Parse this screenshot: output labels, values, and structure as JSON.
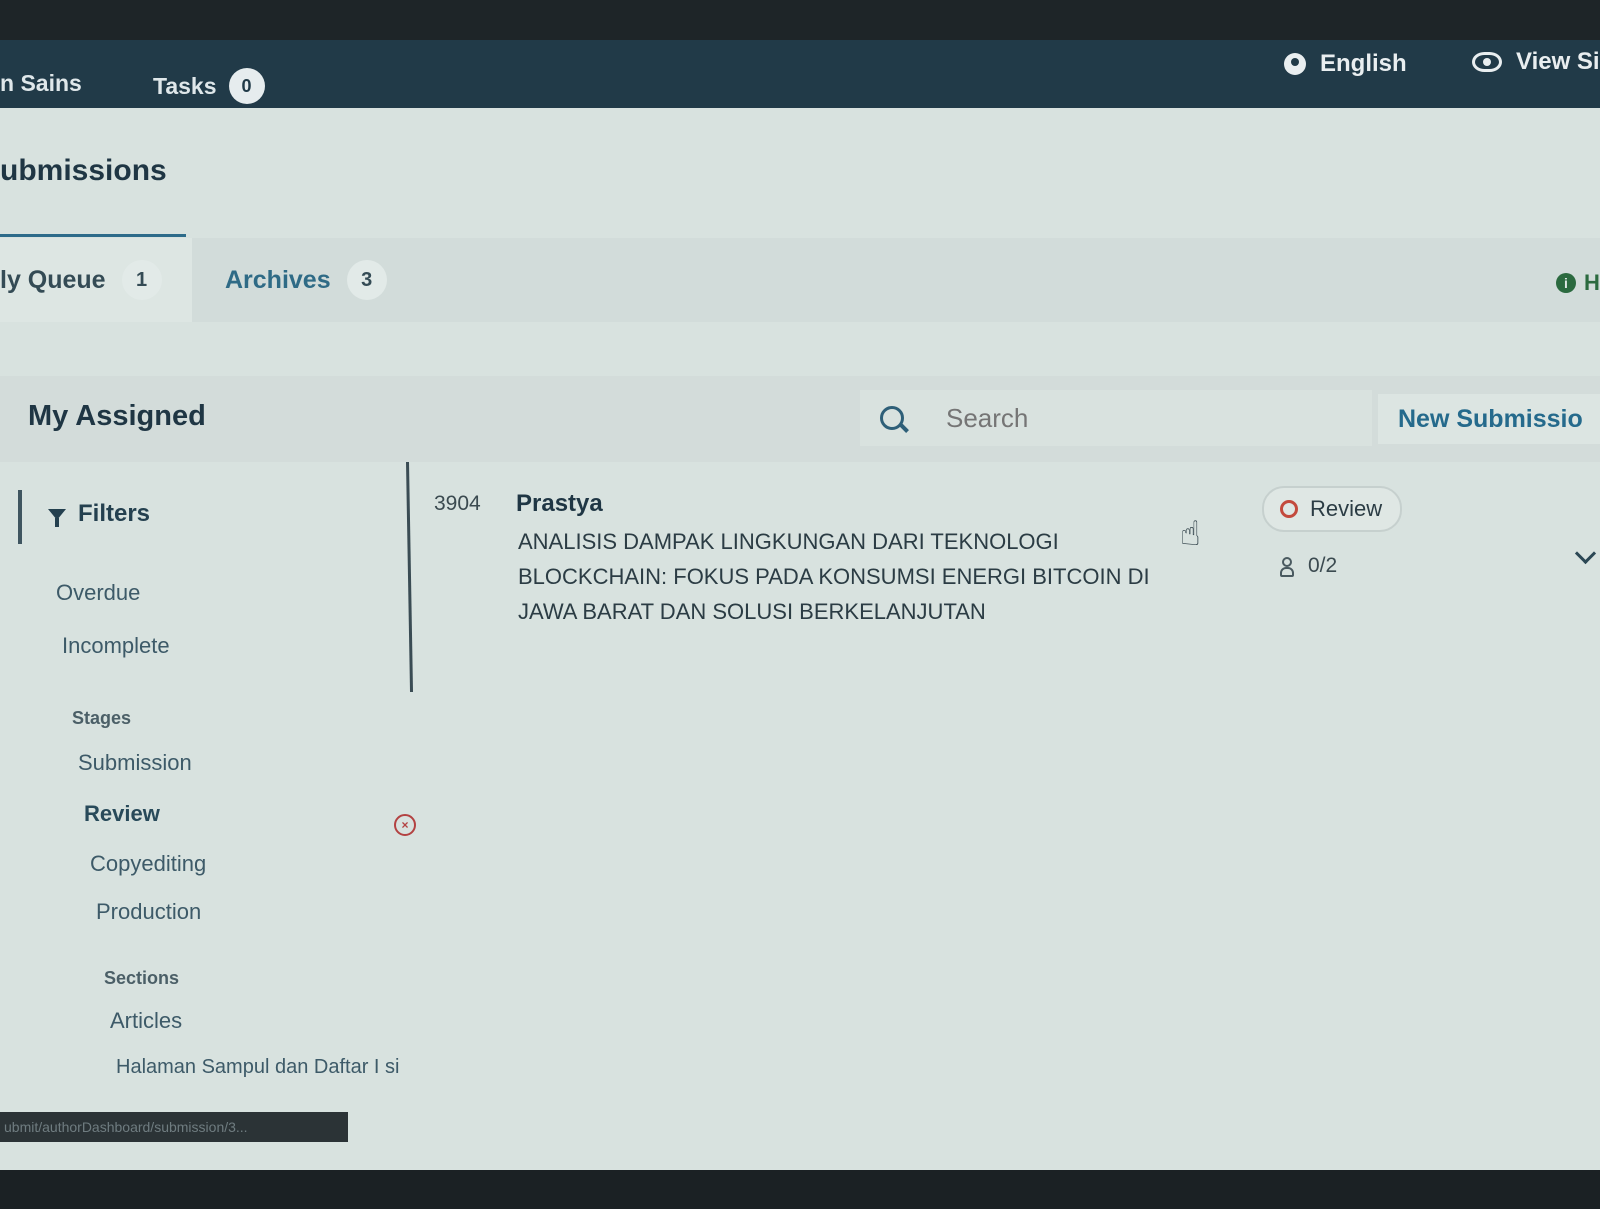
{
  "appbar": {
    "context_name": "n Sains",
    "tasks_label": "Tasks",
    "tasks_count": "0",
    "language_label": "English",
    "view_site_label": "View Si"
  },
  "page": {
    "title": "ubmissions"
  },
  "tabs": [
    {
      "label": "ly Queue",
      "count": "1"
    },
    {
      "label": "Archives",
      "count": "3"
    }
  ],
  "help": {
    "label": "H"
  },
  "list": {
    "title": "My Assigned",
    "search_placeholder": "Search",
    "new_submission_label": "New Submissio"
  },
  "filters": {
    "heading": "Filters",
    "items": [
      "Overdue",
      "Incomplete"
    ],
    "stages_heading": "Stages",
    "stages": [
      "Submission",
      "Review",
      "Copyediting",
      "Production"
    ],
    "selected_stage": "Review",
    "sections_heading": "Sections",
    "sections": [
      "Articles",
      "Halaman Sampul dan Daftar I si"
    ]
  },
  "submission": {
    "id": "3904",
    "author": "Prastya",
    "title": "ANALISIS DAMPAK LINGKUNGAN DARI TEKNOLOGI BLOCKCHAIN: FOKUS PADA KONSUMSI ENERGI BITCOIN DI JAWA BARAT DAN SOLUSI BERKELANJUTAN",
    "stage": "Review",
    "reviews": "0/2"
  },
  "statusbar": {
    "url": "ubmit/authorDashboard/submission/3..."
  },
  "colors": {
    "appbar": "#213a48",
    "accent": "#256a8c",
    "stage_dot": "#c34a3d"
  }
}
